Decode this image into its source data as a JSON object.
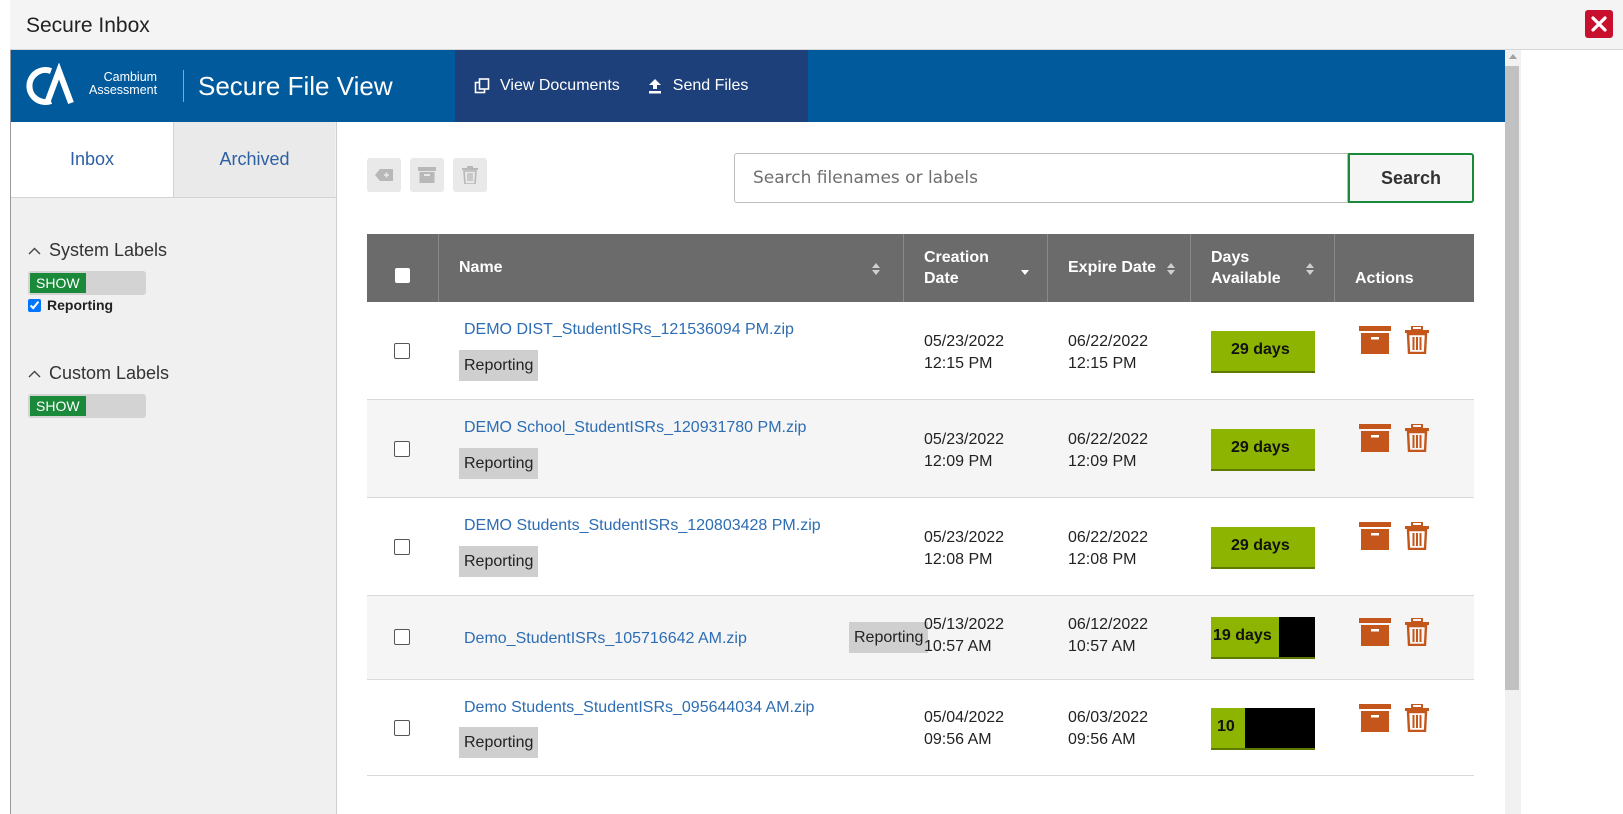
{
  "window": {
    "title": "Secure Inbox"
  },
  "brand": {
    "logo_line1": "Cambium",
    "logo_line2": "Assessment",
    "app_title": "Secure File View",
    "bar_color": "#005a9c"
  },
  "nav": {
    "view_documents": "View Documents",
    "send_files": "Send Files"
  },
  "sidebar": {
    "tabs": [
      "Inbox",
      "Archived"
    ],
    "system_labels": {
      "title": "System Labels",
      "toggle": "SHOW",
      "items": [
        {
          "label": "Reporting",
          "checked": true
        }
      ]
    },
    "custom_labels": {
      "title": "Custom Labels",
      "toggle": "SHOW"
    }
  },
  "search": {
    "placeholder": "Search filenames or labels",
    "button": "Search"
  },
  "table": {
    "headers": {
      "name": "Name",
      "creation_line1": "Creation",
      "creation_line2": "Date",
      "expire": "Expire Date",
      "days_line1": "Days",
      "days_line2": "Available",
      "actions": "Actions"
    },
    "rows": [
      {
        "name": "DEMO DIST_StudentISRs_121536094 PM.zip",
        "tag": "Reporting",
        "created_date": "05/23/2022",
        "created_time": "12:15 PM",
        "expire_date": "06/22/2022",
        "expire_time": "12:15 PM",
        "days": "29 days",
        "days_fraction": 1.0
      },
      {
        "name": "DEMO School_StudentISRs_120931780 PM.zip",
        "tag": "Reporting",
        "created_date": "05/23/2022",
        "created_time": "12:09 PM",
        "expire_date": "06/22/2022",
        "expire_time": "12:09 PM",
        "days": "29 days",
        "days_fraction": 1.0
      },
      {
        "name": "DEMO Students_StudentISRs_120803428 PM.zip",
        "tag": "Reporting",
        "created_date": "05/23/2022",
        "created_time": "12:08 PM",
        "expire_date": "06/22/2022",
        "expire_time": "12:08 PM",
        "days": "29 days",
        "days_fraction": 1.0
      },
      {
        "name": "Demo_StudentISRs_105716642 AM.zip",
        "tag": "Reporting",
        "created_date": "05/13/2022",
        "created_time": "10:57 AM",
        "expire_date": "06/12/2022",
        "expire_time": "10:57 AM",
        "days": "19 days",
        "days_fraction": 0.65
      },
      {
        "name": "Demo Students_StudentISRs_095644034 AM.zip",
        "tag": "Reporting",
        "created_date": "05/04/2022",
        "created_time": "09:56 AM",
        "expire_date": "06/03/2022",
        "expire_time": "09:56 AM",
        "days": "10",
        "days_fraction": 0.33
      }
    ]
  },
  "colors": {
    "accent_green": "#1a8a3a",
    "days_green": "#8cb400",
    "action_orange": "#c4561b",
    "link_blue": "#2d6db3",
    "close_red": "#c8102e"
  }
}
